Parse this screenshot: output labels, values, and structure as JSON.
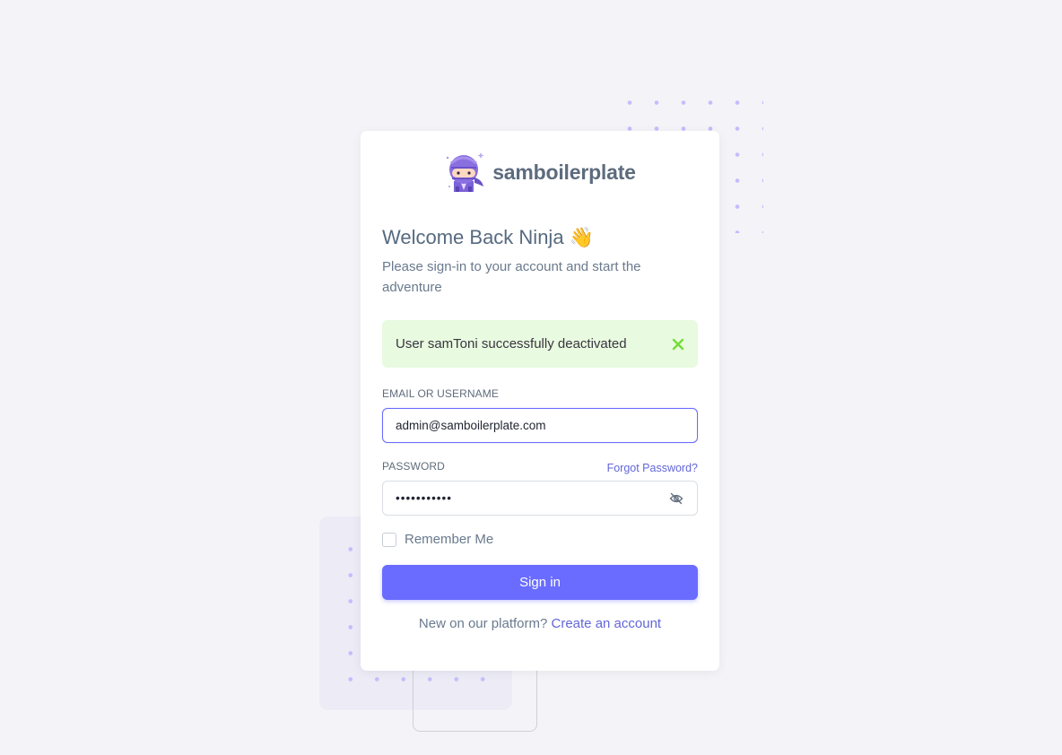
{
  "brand": {
    "name": "samboilerplate",
    "logo_icon": "ninja-mascot-icon"
  },
  "welcome": {
    "title": "Welcome Back Ninja 👋",
    "subtitle": "Please sign-in to your account and start the adventure"
  },
  "alert": {
    "message": "User samToni successfully deactivated",
    "close_icon": "close-icon",
    "color": "#71dd37"
  },
  "form": {
    "email_label": "EMAIL OR USERNAME",
    "email_value": "admin@samboilerplate.com",
    "password_label": "PASSWORD",
    "password_value": "•••••••••••",
    "forgot_password": "Forgot Password?",
    "toggle_icon": "eye-off-icon",
    "remember_label": "Remember Me",
    "remember_checked": false,
    "submit_label": "Sign in"
  },
  "footer": {
    "prompt": "New on our platform? ",
    "link_text": "Create an account"
  },
  "colors": {
    "primary": "#696cff",
    "background": "#f4f4f8",
    "alert_background": "#e8fadf"
  }
}
